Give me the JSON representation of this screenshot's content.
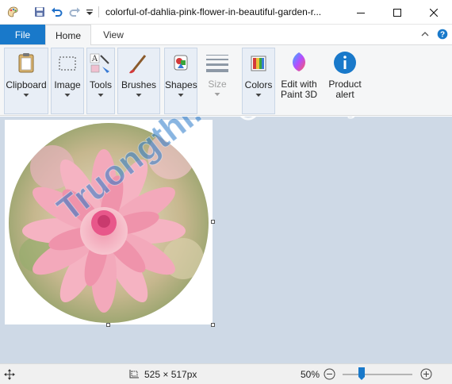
{
  "window": {
    "title": "colorful-of-dahlia-pink-flower-in-beautiful-garden-r..."
  },
  "quick_access": {
    "icons": [
      "paint-app-icon",
      "save-icon",
      "undo-icon",
      "redo-icon",
      "chevron-down-icon"
    ]
  },
  "tabs": {
    "file": "File",
    "home": "Home",
    "view": "View"
  },
  "ribbon": {
    "groups": [
      {
        "label": "Clipboard",
        "icon": "clipboard-icon",
        "has_dropdown": true
      },
      {
        "label": "Image",
        "icon": "image-select-icon",
        "has_dropdown": true
      },
      {
        "label": "Tools",
        "icon": "tools-icon",
        "has_dropdown": true
      },
      {
        "label": "Brushes",
        "icon": "brush-icon",
        "has_dropdown": true
      },
      {
        "label": "Shapes",
        "icon": "shapes-icon",
        "has_dropdown": true
      },
      {
        "label": "Size",
        "icon": "line-size-icon",
        "has_dropdown": true,
        "disabled": true
      },
      {
        "label": "Colors",
        "icon": "colors-icon",
        "has_dropdown": true
      },
      {
        "label": "Edit with\nPaint 3D",
        "icon": "paint-3d-icon",
        "has_dropdown": false
      },
      {
        "label": "Product\nalert",
        "icon": "info-icon",
        "has_dropdown": false
      }
    ]
  },
  "canvas": {
    "image": "dahlia-flower-photo-circle"
  },
  "watermark": {
    "left": "Truongthi.top",
    "right": "uantrimang"
  },
  "status": {
    "dimensions": "525 × 517px",
    "zoom": "50%",
    "zoom_level": 0.5
  },
  "colors": {
    "file_tab": "#1979ca",
    "ribbon_bg": "#f5f6f7",
    "workspace_bg": "#ced9e6",
    "zoom_thumb": "#1979ca"
  }
}
